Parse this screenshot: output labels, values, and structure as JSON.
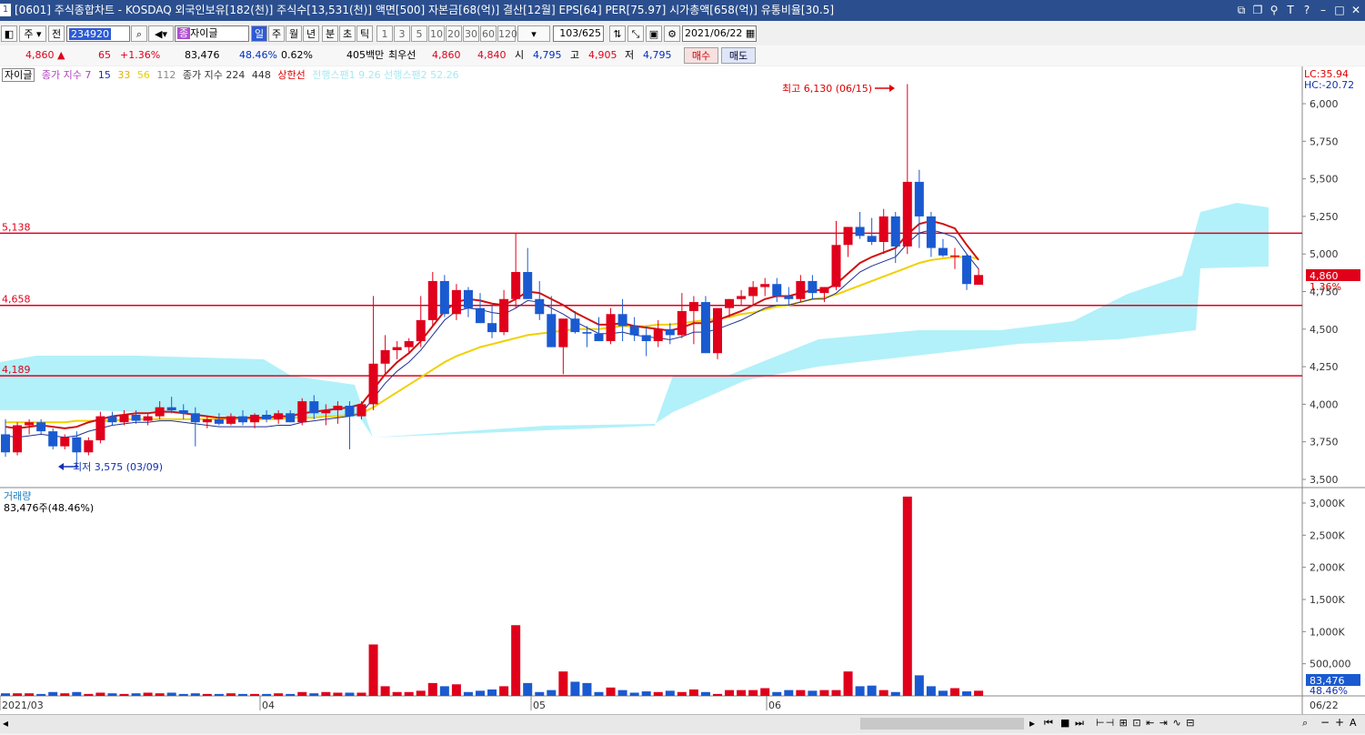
{
  "window": {
    "title": "[0601] 주식종합차트 - KOSDAQ 외국인보유[182(천)] 주식수[13,531(천)] 액면[500] 자본금[68(억)] 결산[12월] EPS[64] PER[75.97] 시가총액[658(억)] 유통비율[30.5]",
    "sys_icon": "1"
  },
  "toolbar": {
    "period_label": "주",
    "all_label": "전",
    "code_value": "234920",
    "name_prefix": "종",
    "name_value": "자이글",
    "tabs": [
      "일",
      "주",
      "월",
      "년",
      "분",
      "초",
      "틱"
    ],
    "num_buttons": [
      "1",
      "3",
      "5",
      "10",
      "20",
      "30",
      "60",
      "120"
    ],
    "count_value": "103/625",
    "date_value": "2021/06/22"
  },
  "quote": {
    "price": "4,860",
    "arrow": "▲",
    "change": "65",
    "change_pct": "+1.36%",
    "volume": "83,476",
    "vol_ratio": "48.46%",
    "turnover": "0.62%",
    "amount": "405백만",
    "best_label": "최우선",
    "best_ask": "4,860",
    "best_bid": "4,840",
    "open_label": "시",
    "open": "4,795",
    "high_label": "고",
    "high": "4,905",
    "low_label": "저",
    "low": "4,795",
    "buy_label": "매수",
    "sell_label": "매도"
  },
  "legend": {
    "name": "자이글",
    "ma1": "종가 지수 7",
    "ma2": "15",
    "ma3": "33",
    "ma4": "56",
    "ma5": "112",
    "ma6": "종가 지수 224",
    "ma7": "448",
    "limit": "상한선",
    "ichimoku": "전행스팬1 9.26 선행스팬2 52.26"
  },
  "volume_panel": {
    "title": "거래량",
    "value": "83,476주(48.46%)"
  },
  "chart_data": {
    "type": "candlestick",
    "price_axis": {
      "min": 3500,
      "max": 6000,
      "ticks": [
        "6,000",
        "5,750",
        "5,500",
        "5,250",
        "5,000",
        "4,750",
        "4,500",
        "4,250",
        "4,000",
        "3,750",
        "3,500"
      ]
    },
    "volume_axis": {
      "ticks": [
        "3,000K",
        "2,500K",
        "2,000K",
        "1,500K",
        "1,000K",
        "500,000"
      ]
    },
    "x_labels": [
      "2021/03",
      "04",
      "05",
      "06",
      "06/22"
    ],
    "top_labels": [
      "LC:35.94",
      "HC:-20.72"
    ],
    "hlines": [
      {
        "label": "5,138",
        "value": 5138
      },
      {
        "label": "4,658",
        "value": 4658
      },
      {
        "label": "4,189",
        "value": 4189
      }
    ],
    "high_annotation": "최고 6,130 (06/15)",
    "low_annotation": "최저 3,575 (03/09)",
    "price_tag": "4,860",
    "pct_tag": "1.36%",
    "vol_tag": "83,476",
    "vol_pct_tag": "48.46%",
    "candles": [
      [
        3800,
        3900,
        3650,
        3680
      ],
      [
        3680,
        3880,
        3660,
        3860
      ],
      [
        3860,
        3900,
        3800,
        3880
      ],
      [
        3880,
        3900,
        3800,
        3820
      ],
      [
        3820,
        3840,
        3700,
        3720
      ],
      [
        3720,
        3800,
        3700,
        3780
      ],
      [
        3780,
        3820,
        3575,
        3680
      ],
      [
        3680,
        3780,
        3660,
        3760
      ],
      [
        3760,
        3950,
        3740,
        3920
      ],
      [
        3920,
        3950,
        3860,
        3880
      ],
      [
        3880,
        3960,
        3860,
        3930
      ],
      [
        3930,
        3960,
        3870,
        3890
      ],
      [
        3890,
        3940,
        3860,
        3920
      ],
      [
        3920,
        4020,
        3900,
        3980
      ],
      [
        3980,
        4050,
        3940,
        3960
      ],
      [
        3960,
        4000,
        3900,
        3940
      ],
      [
        3940,
        3980,
        3720,
        3880
      ],
      [
        3880,
        3920,
        3840,
        3900
      ],
      [
        3900,
        3940,
        3860,
        3870
      ],
      [
        3870,
        3940,
        3860,
        3920
      ],
      [
        3920,
        3960,
        3860,
        3880
      ],
      [
        3880,
        3940,
        3840,
        3930
      ],
      [
        3930,
        3960,
        3880,
        3900
      ],
      [
        3900,
        3960,
        3870,
        3940
      ],
      [
        3940,
        3960,
        3880,
        3880
      ],
      [
        3880,
        4040,
        3860,
        4020
      ],
      [
        4020,
        4060,
        3900,
        3940
      ],
      [
        3940,
        4000,
        3860,
        3960
      ],
      [
        3960,
        4020,
        3870,
        3990
      ],
      [
        3990,
        4020,
        3700,
        3920
      ],
      [
        3920,
        4020,
        3900,
        4000
      ],
      [
        4000,
        4720,
        3960,
        4270
      ],
      [
        4270,
        4460,
        4200,
        4360
      ],
      [
        4360,
        4420,
        4300,
        4380
      ],
      [
        4380,
        4440,
        4340,
        4420
      ],
      [
        4420,
        4720,
        4380,
        4560
      ],
      [
        4560,
        4880,
        4520,
        4820
      ],
      [
        4820,
        4860,
        4580,
        4600
      ],
      [
        4600,
        4800,
        4560,
        4760
      ],
      [
        4760,
        4780,
        4580,
        4640
      ],
      [
        4640,
        4740,
        4540,
        4540
      ],
      [
        4540,
        4660,
        4440,
        4480
      ],
      [
        4480,
        4760,
        4460,
        4700
      ],
      [
        4700,
        5140,
        4640,
        4880
      ],
      [
        4880,
        5040,
        4820,
        4700
      ],
      [
        4700,
        4820,
        4560,
        4600
      ],
      [
        4600,
        4720,
        4380,
        4380
      ],
      [
        4380,
        4500,
        4200,
        4570
      ],
      [
        4570,
        4620,
        4470,
        4480
      ],
      [
        4480,
        4520,
        4380,
        4470
      ],
      [
        4470,
        4580,
        4450,
        4420
      ],
      [
        4420,
        4640,
        4400,
        4600
      ],
      [
        4600,
        4700,
        4420,
        4520
      ],
      [
        4520,
        4580,
        4420,
        4460
      ],
      [
        4460,
        4520,
        4320,
        4420
      ],
      [
        4420,
        4560,
        4380,
        4500
      ],
      [
        4500,
        4540,
        4400,
        4460
      ],
      [
        4460,
        4740,
        4440,
        4620
      ],
      [
        4620,
        4720,
        4400,
        4680
      ],
      [
        4680,
        4720,
        4500,
        4340
      ],
      [
        4340,
        4560,
        4300,
        4640
      ],
      [
        4640,
        4700,
        4580,
        4700
      ],
      [
        4700,
        4760,
        4660,
        4720
      ],
      [
        4720,
        4820,
        4660,
        4780
      ],
      [
        4780,
        4840,
        4720,
        4800
      ],
      [
        4800,
        4840,
        4680,
        4720
      ],
      [
        4720,
        4780,
        4660,
        4700
      ],
      [
        4700,
        4860,
        4680,
        4820
      ],
      [
        4820,
        4860,
        4700,
        4740
      ],
      [
        4740,
        4780,
        4680,
        4780
      ],
      [
        4780,
        5220,
        4760,
        5060
      ],
      [
        5060,
        5180,
        4980,
        5180
      ],
      [
        5180,
        5280,
        5100,
        5120
      ],
      [
        5120,
        5240,
        5060,
        5080
      ],
      [
        5080,
        5300,
        5000,
        5250
      ],
      [
        5250,
        5280,
        4940,
        5050
      ],
      [
        5050,
        6130,
        5000,
        5480
      ],
      [
        5480,
        5560,
        5040,
        5250
      ],
      [
        5250,
        5280,
        4980,
        5040
      ],
      [
        5040,
        5100,
        4980,
        4990
      ],
      [
        4990,
        5040,
        4900,
        4990
      ],
      [
        4990,
        5000,
        4760,
        4800
      ],
      [
        4795,
        4905,
        4795,
        4860
      ]
    ],
    "volumes": [
      40,
      40,
      40,
      30,
      60,
      40,
      60,
      30,
      50,
      40,
      30,
      40,
      50,
      40,
      50,
      30,
      40,
      30,
      30,
      40,
      30,
      30,
      30,
      40,
      30,
      60,
      40,
      60,
      50,
      50,
      50,
      800,
      150,
      60,
      60,
      80,
      200,
      150,
      180,
      60,
      80,
      100,
      150,
      1100,
      200,
      60,
      90,
      380,
      220,
      200,
      60,
      130,
      90,
      50,
      70,
      60,
      80,
      60,
      100,
      60,
      30,
      90,
      90,
      90,
      120,
      60,
      90,
      90,
      80,
      90,
      90,
      380,
      150,
      160,
      90,
      60,
      3100,
      320,
      150,
      80,
      120,
      70,
      80
    ],
    "ma_short": [
      3850,
      3840,
      3850,
      3860,
      3850,
      3840,
      3850,
      3880,
      3900,
      3920,
      3930,
      3940,
      3940,
      3950,
      3950,
      3940,
      3930,
      3920,
      3910,
      3910,
      3910,
      3910,
      3910,
      3920,
      3920,
      3940,
      3950,
      3960,
      3970,
      3980,
      4000,
      4100,
      4200,
      4280,
      4340,
      4420,
      4520,
      4620,
      4680,
      4700,
      4690,
      4670,
      4660,
      4700,
      4750,
      4740,
      4700,
      4660,
      4610,
      4570,
      4530,
      4530,
      4540,
      4520,
      4510,
      4500,
      4490,
      4510,
      4540,
      4540,
      4560,
      4590,
      4620,
      4660,
      4700,
      4720,
      4720,
      4740,
      4760,
      4760,
      4800,
      4870,
      4940,
      4980,
      5010,
      5040,
      5130,
      5200,
      5220,
      5200,
      5170,
      5060,
      4960
    ],
    "ma_mid": [
      3880,
      3880,
      3880,
      3880,
      3880,
      3880,
      3890,
      3890,
      3890,
      3890,
      3900,
      3900,
      3900,
      3900,
      3900,
      3900,
      3900,
      3900,
      3900,
      3900,
      3900,
      3900,
      3900,
      3900,
      3910,
      3910,
      3910,
      3920,
      3920,
      3930,
      3940,
      3980,
      4030,
      4080,
      4130,
      4180,
      4230,
      4280,
      4320,
      4350,
      4380,
      4400,
      4420,
      4440,
      4460,
      4470,
      4480,
      4490,
      4500,
      4500,
      4500,
      4510,
      4520,
      4520,
      4520,
      4530,
      4530,
      4540,
      4550,
      4560,
      4570,
      4580,
      4600,
      4610,
      4630,
      4650,
      4660,
      4680,
      4700,
      4710,
      4730,
      4760,
      4790,
      4820,
      4850,
      4880,
      4910,
      4940,
      4960,
      4970,
      4980,
      4980,
      4970
    ]
  }
}
